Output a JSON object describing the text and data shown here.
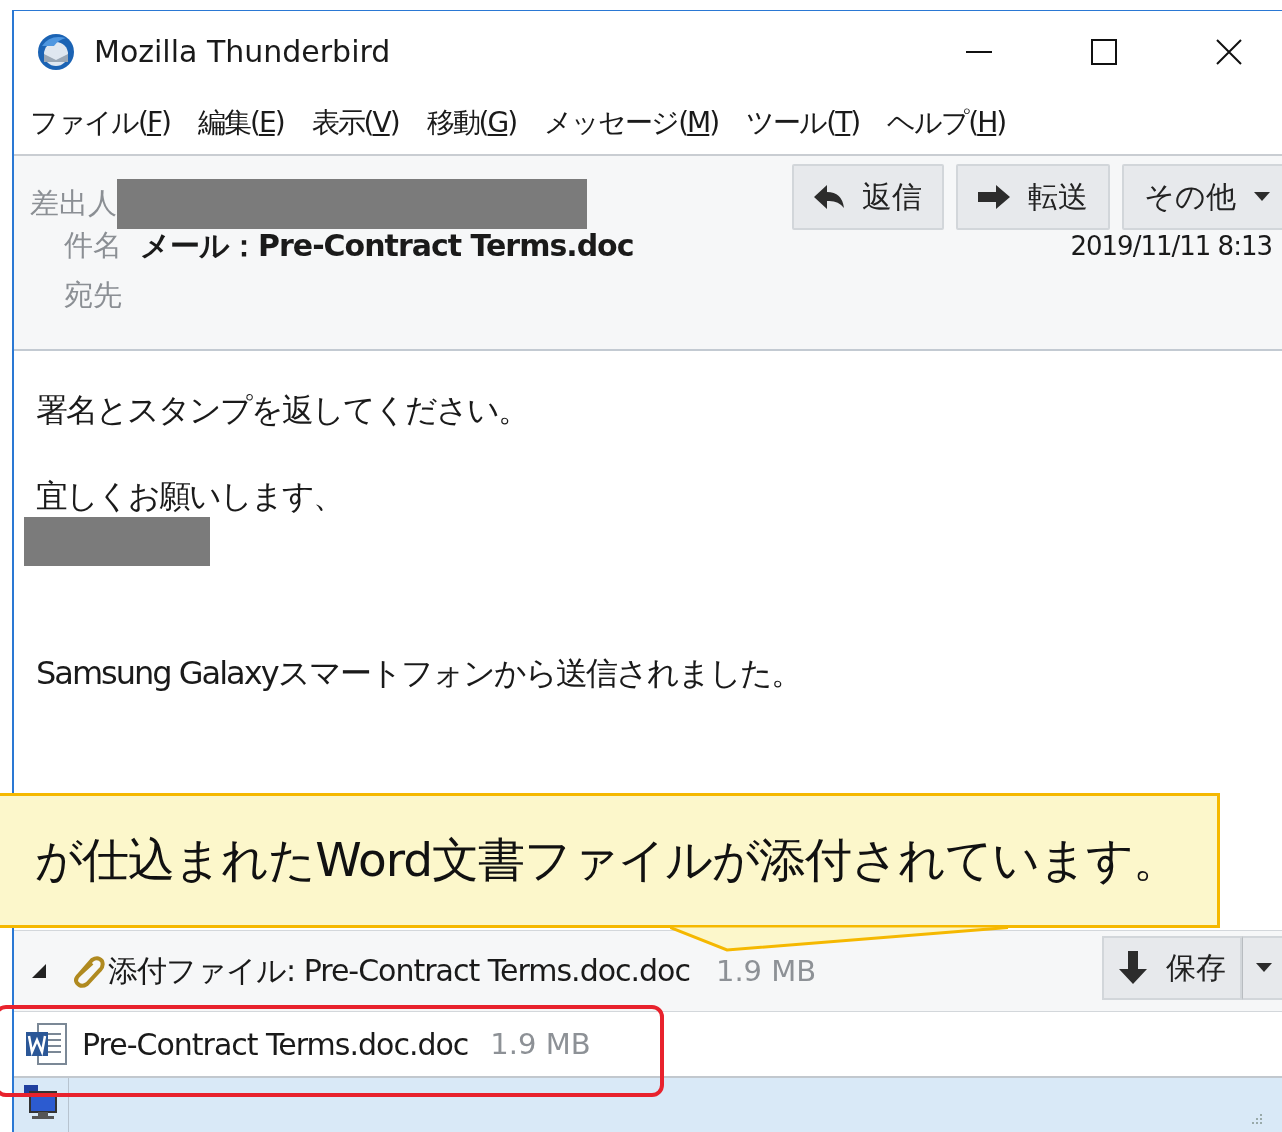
{
  "window": {
    "title": "Mozilla Thunderbird"
  },
  "menu": [
    {
      "before": "ファイル(",
      "key": "F",
      "after": ")"
    },
    {
      "before": "編集(",
      "key": "E",
      "after": ")"
    },
    {
      "before": "表示(",
      "key": "V",
      "after": ")"
    },
    {
      "before": "移動(",
      "key": "G",
      "after": ")"
    },
    {
      "before": "メッセージ(",
      "key": "M",
      "after": ")"
    },
    {
      "before": "ツール(",
      "key": "T",
      "after": ")"
    },
    {
      "before": "ヘルプ(",
      "key": "H",
      "after": ")"
    }
  ],
  "header": {
    "from_label": "差出人",
    "subject_label": "件名",
    "subject": "メール：Pre-Contract Terms.doc",
    "date": "2019/11/11 8:13",
    "to_label": "宛先",
    "buttons": [
      {
        "kind": "reply",
        "label": "返信"
      },
      {
        "kind": "forward",
        "label": "転送"
      },
      {
        "kind": "more",
        "label": "その他"
      }
    ]
  },
  "body": [
    {
      "kind": "text",
      "text": "署名とスタンプを返してください。"
    },
    {
      "kind": "text",
      "text": "宜しくお願いします、"
    },
    {
      "kind": "redacted"
    },
    {
      "kind": "gap"
    },
    {
      "kind": "text",
      "text": "Samsung Galaxyスマートフォンから送信されました。"
    }
  ],
  "attachments": {
    "expanded": true,
    "label": "添付ファイル: Pre-Contract Terms.doc.doc",
    "size": "1.9 MB",
    "save_label": "保存",
    "items": [
      {
        "name": "Pre-Contract Terms.doc.doc",
        "size": "1.9 MB"
      }
    ]
  },
  "callout": {
    "text": "が仕込まれたWord文書ファイルが添付されています。"
  }
}
